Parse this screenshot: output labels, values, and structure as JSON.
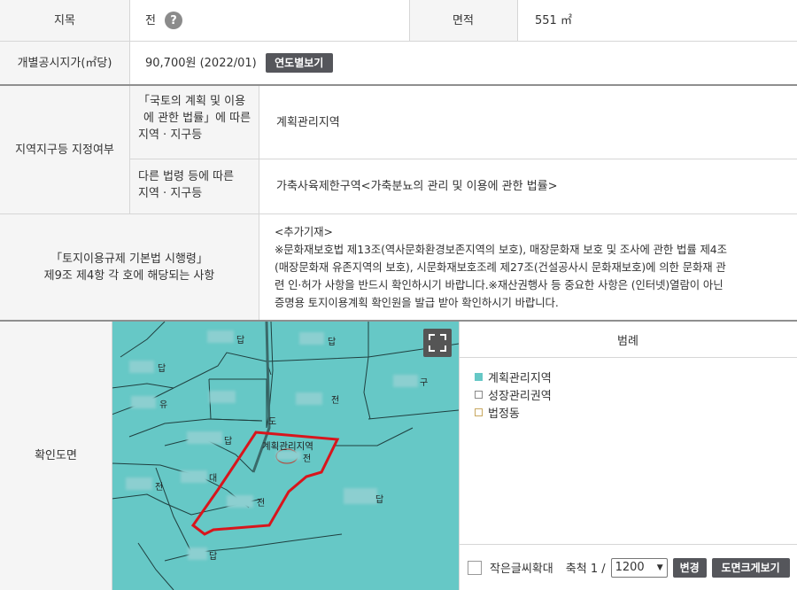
{
  "row1": {
    "jimok_label": "지목",
    "jimok_value": "전",
    "help_icon": "?",
    "area_label": "면적",
    "area_value": "551 ㎡"
  },
  "row2": {
    "price_label": "개별공시지가(㎡당)",
    "price_value": "90,700원 (2022/01)",
    "yearly_button": "연도별보기"
  },
  "zone": {
    "label": "지역지구등 지정여부",
    "sub1_label_line1": "「국토의 계획 및 이용",
    "sub1_label_line2": "에 관한 법률」에 따른",
    "sub1_label_line3": "지역 · 지구등",
    "sub1_value": "계획관리지역",
    "sub2_label_line1": "다른 법령 등에 따른",
    "sub2_label_line2": "지역 · 지구등",
    "sub2_value": "가축사육제한구역<가축분뇨의 관리 및 이용에 관한 법률>"
  },
  "decree": {
    "label_line1": "「토지이용규제 기본법 시행령」",
    "label_line2": "제9조 제4항 각 호에 해당되는 사항",
    "lines": [
      "<추가기재>",
      "※문화재보호법 제13조(역사문화환경보존지역의 보호), 매장문화재 보호 및 조사에 관한 법률 제4조",
      "(매장문화재 유존지역의 보호), 시문화재보호조례 제27조(건설공사시 문화재보호)에 의한 문화재 관",
      "련 인·허가 사항을 반드시 확인하시기 바랍니다.※재산권행사 등 중요한 사항은 (인터넷)열람이 아닌",
      "증명용 토지이용계획 확인원을 발급 받아 확인하시기 바랍니다."
    ]
  },
  "map_section": {
    "label": "확인도면",
    "map_labels": {
      "dap1": "답",
      "dap2": "답",
      "dap3": "답",
      "yu": "유",
      "jeon1": "전",
      "dap4": "답",
      "dae": "대",
      "jeon2": "전",
      "jeon3": "전",
      "dap5": "답",
      "dap6": "답",
      "gu": "구",
      "parcel_zone": "계획관리지역",
      "parcel_jeon": "전",
      "road": "도"
    },
    "legend_title": "범례",
    "legend": [
      {
        "label": "계획관리지역",
        "color": "#66c8c6",
        "filled": true
      },
      {
        "label": "성장관리권역",
        "color": "#888888",
        "filled": false
      },
      {
        "label": "법정동",
        "color": "#c8a860",
        "filled": false
      }
    ],
    "small_text_label": "작은글씨확대",
    "scale_label": "축척 1 /",
    "scale_value": "1200",
    "change_button": "변경",
    "enlarge_button": "도면크게보기"
  }
}
